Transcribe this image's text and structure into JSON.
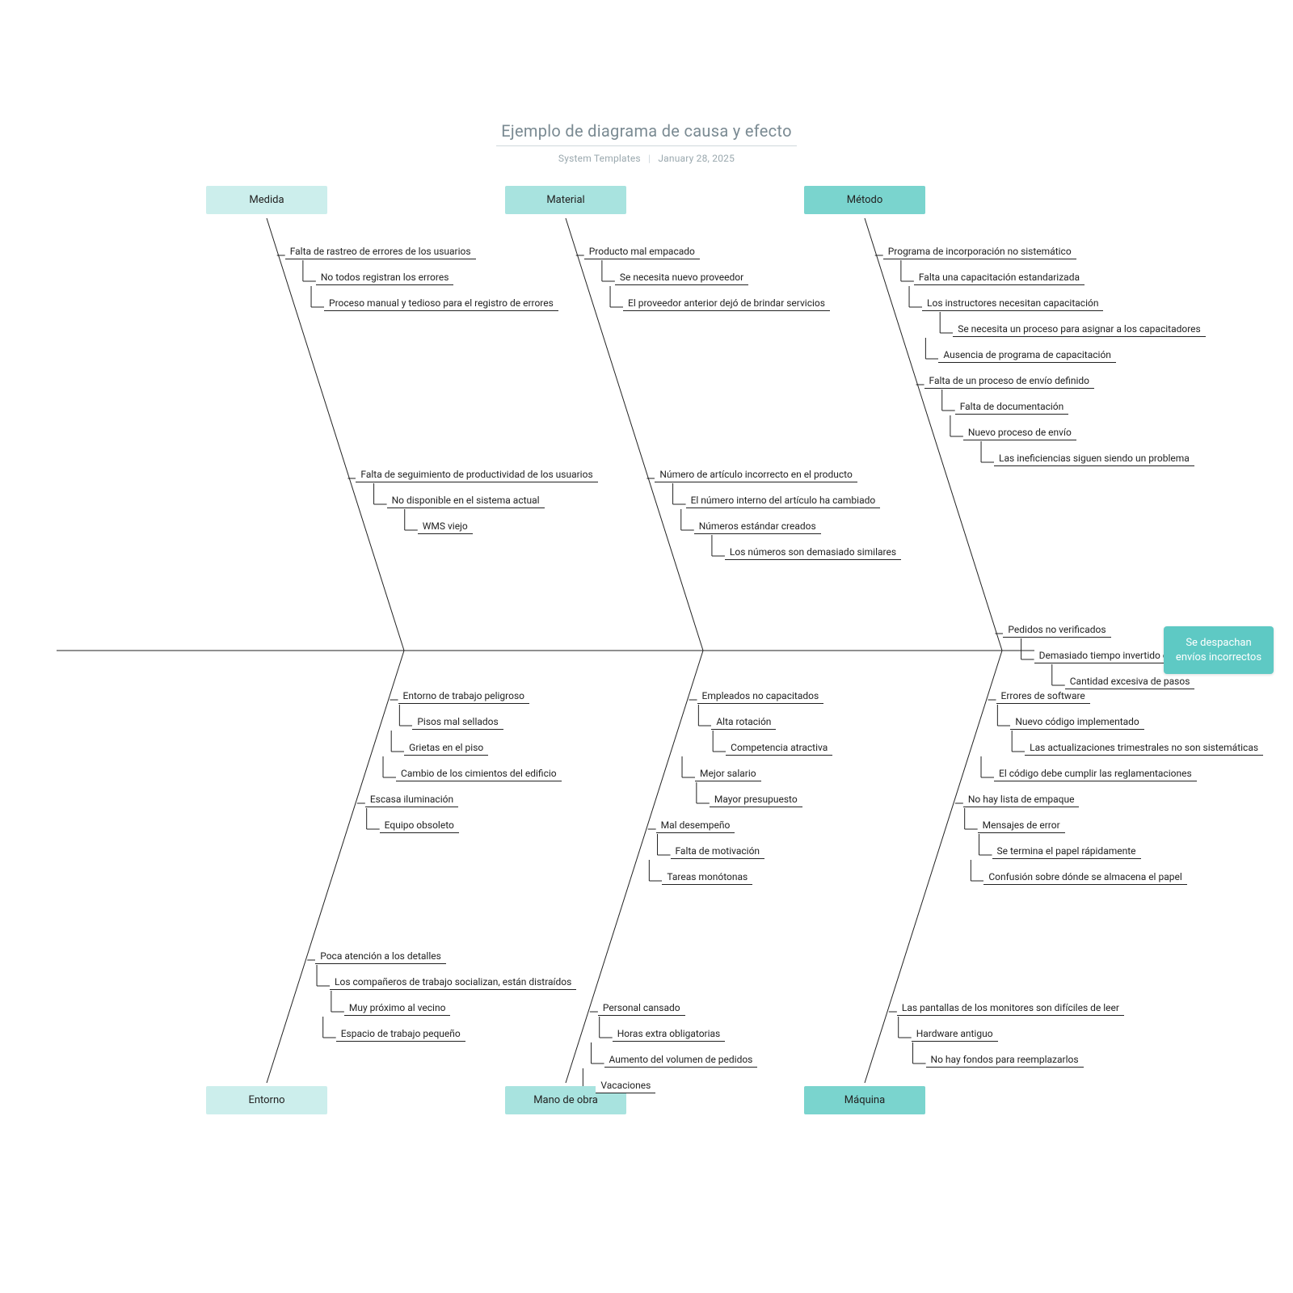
{
  "title": "Ejemplo de diagrama de causa y efecto",
  "subtitle_left": "System Templates",
  "subtitle_right": "January 28, 2025",
  "effect": "Se despachan envíos incorrectos",
  "categories": {
    "medida": "Medida",
    "material": "Material",
    "metodo": "Método",
    "entorno": "Entorno",
    "mano": "Mano de obra",
    "maquina": "Máquina"
  },
  "cat_colors": {
    "medida": "#cceeec",
    "material": "#a8e3df",
    "metodo": "#7ad4ce",
    "entorno": "#cceeec",
    "mano": "#a8e3df",
    "maquina": "#7ad4ce"
  },
  "leaves": {
    "medida": [
      {
        "d": 0,
        "t": "Falta de rastreo de errores de los usuarios"
      },
      {
        "d": 1,
        "t": "No todos registran los errores"
      },
      {
        "d": 1,
        "t": "Proceso manual y tedioso para el registro de errores"
      },
      {
        "d": 0,
        "sep": 1,
        "t": "Falta de seguimiento de productividad de los usuarios"
      },
      {
        "d": 1,
        "t": "No disponible en el sistema actual"
      },
      {
        "d": 2,
        "t": "WMS viejo"
      }
    ],
    "material": [
      {
        "d": 0,
        "t": "Producto mal empacado"
      },
      {
        "d": 1,
        "t": "Se necesita nuevo proveedor"
      },
      {
        "d": 1,
        "t": "El proveedor anterior dejó de brindar servicios"
      },
      {
        "d": 0,
        "sep": 1,
        "t": "Número de artículo incorrecto en el producto"
      },
      {
        "d": 1,
        "t": "El número interno del artículo ha cambiado"
      },
      {
        "d": 1,
        "t": "Números estándar creados"
      },
      {
        "d": 2,
        "t": "Los números son demasiado similares"
      }
    ],
    "metodo": [
      {
        "d": 0,
        "t": "Programa de incorporación no sistemático"
      },
      {
        "d": 1,
        "t": "Falta una capacitación estandarizada"
      },
      {
        "d": 1,
        "t": "Los instructores necesitan capacitación"
      },
      {
        "d": 2,
        "t": "Se necesita un proceso para asignar a los capacitadores"
      },
      {
        "d": 1,
        "t": "Ausencia de programa de capacitación"
      },
      {
        "d": 0,
        "t": "Falta de un proceso de envío definido"
      },
      {
        "d": 1,
        "t": "Falta de documentación"
      },
      {
        "d": 1,
        "t": "Nuevo proceso de envío"
      },
      {
        "d": 2,
        "t": "Las ineficiencias siguen siendo un problema"
      },
      {
        "d": 0,
        "sep": 1,
        "t": "Pedidos no verificados"
      },
      {
        "d": 1,
        "t": "Demasiado tiempo invertido en la verificación"
      },
      {
        "d": 2,
        "t": "Cantidad excesiva de pasos"
      }
    ],
    "entorno": [
      {
        "d": 0,
        "t": "Entorno de trabajo peligroso"
      },
      {
        "d": 1,
        "t": "Pisos mal sellados"
      },
      {
        "d": 1,
        "t": "Grietas en el piso"
      },
      {
        "d": 1,
        "t": "Cambio de los cimientos del edificio"
      },
      {
        "d": 0,
        "t": "Escasa iluminación"
      },
      {
        "d": 1,
        "t": "Equipo obsoleto"
      },
      {
        "d": 0,
        "sep": 1,
        "t": "Poca atención a los detalles"
      },
      {
        "d": 1,
        "t": "Los compañeros de trabajo socializan, están distraídos"
      },
      {
        "d": 2,
        "t": "Muy próximo al vecino"
      },
      {
        "d": 2,
        "t": "Espacio de trabajo pequeño"
      }
    ],
    "mano": [
      {
        "d": 0,
        "t": "Empleados no capacitados"
      },
      {
        "d": 1,
        "t": "Alta rotación"
      },
      {
        "d": 2,
        "t": "Competencia atractiva"
      },
      {
        "d": 1,
        "t": "Mejor salario"
      },
      {
        "d": 2,
        "t": "Mayor presupuesto"
      },
      {
        "d": 0,
        "t": "Mal desempeño"
      },
      {
        "d": 1,
        "t": "Falta de motivación"
      },
      {
        "d": 1,
        "t": "Tareas monótonas"
      },
      {
        "d": 0,
        "sep": 1,
        "t": "Personal cansado"
      },
      {
        "d": 1,
        "t": "Horas extra obligatorias"
      },
      {
        "d": 1,
        "t": "Aumento del volumen de pedidos"
      },
      {
        "d": 1,
        "t": "Vacaciones"
      }
    ],
    "maquina": [
      {
        "d": 0,
        "t": "Errores de software"
      },
      {
        "d": 1,
        "t": "Nuevo código implementado"
      },
      {
        "d": 2,
        "t": "Las actualizaciones trimestrales no son sistemáticas"
      },
      {
        "d": 1,
        "t": "El código debe cumplir las reglamentaciones"
      },
      {
        "d": 0,
        "t": "No hay lista de empaque"
      },
      {
        "d": 1,
        "t": "Mensajes de error"
      },
      {
        "d": 2,
        "t": "Se termina el papel rápidamente"
      },
      {
        "d": 2,
        "t": "Confusión sobre dónde se almacena el papel"
      },
      {
        "d": 0,
        "sep": 1,
        "t": "Las pantallas de los monitores son difíciles de leer"
      },
      {
        "d": 1,
        "t": "Hardware antiguo"
      },
      {
        "d": 2,
        "t": "No hay fondos para reemplazarlos"
      }
    ]
  }
}
